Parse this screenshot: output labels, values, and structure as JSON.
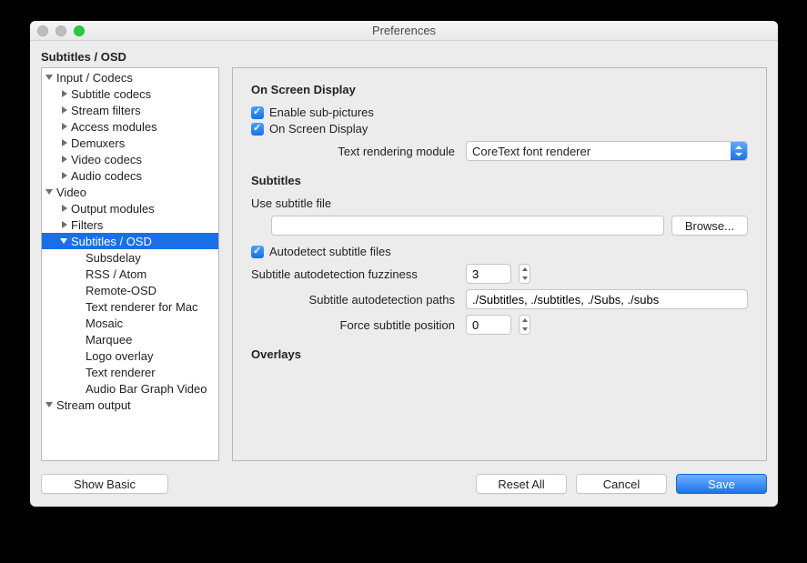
{
  "window": {
    "title": "Preferences"
  },
  "breadcrumb": "Subtitles / OSD",
  "tree": {
    "input_codecs": "Input / Codecs",
    "subtitle_codecs": "Subtitle codecs",
    "stream_filters": "Stream filters",
    "access_modules": "Access modules",
    "demuxers": "Demuxers",
    "video_codecs": "Video codecs",
    "audio_codecs": "Audio codecs",
    "video": "Video",
    "output_modules": "Output modules",
    "filters": "Filters",
    "subtitles_osd": "Subtitles / OSD",
    "subsdelay": "Subsdelay",
    "rss_atom": "RSS / Atom",
    "remote_osd": "Remote-OSD",
    "text_renderer_mac": "Text renderer for Mac",
    "mosaic": "Mosaic",
    "marquee": "Marquee",
    "logo_overlay": "Logo overlay",
    "text_renderer": "Text renderer",
    "audio_bar_graph": "Audio Bar Graph Video",
    "stream_output": "Stream output"
  },
  "osd": {
    "heading": "On Screen Display",
    "enable_sub_pictures": "Enable sub-pictures",
    "on_screen_display": "On Screen Display",
    "text_rendering_label": "Text rendering module",
    "text_rendering_value": "CoreText font renderer"
  },
  "subtitles": {
    "heading": "Subtitles",
    "use_file_label": "Use subtitle file",
    "use_file_value": "",
    "browse": "Browse...",
    "autodetect": "Autodetect subtitle files",
    "fuzziness_label": "Subtitle autodetection fuzziness",
    "fuzziness_value": "3",
    "paths_label": "Subtitle autodetection paths",
    "paths_value": "./Subtitles, ./subtitles, ./Subs, ./subs",
    "force_pos_label": "Force subtitle position",
    "force_pos_value": "0"
  },
  "overlays": {
    "heading": "Overlays"
  },
  "footer": {
    "show_basic": "Show Basic",
    "reset_all": "Reset All",
    "cancel": "Cancel",
    "save": "Save"
  }
}
